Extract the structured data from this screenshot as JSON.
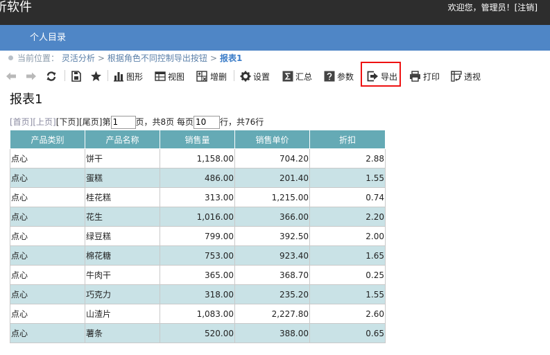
{
  "header": {
    "app_title": "析软件",
    "welcome_prefix": "欢迎您，管理员！[",
    "logout": "注销",
    "welcome_suffix": "]"
  },
  "nav": {
    "item": "个人目录"
  },
  "breadcrumb": {
    "label": "当前位置：",
    "items": [
      "灵活分析",
      "根据角色不同控制导出按钮",
      "报表1"
    ],
    "separator": ">"
  },
  "toolbar": {
    "chart": "图形",
    "view": "视图",
    "edit": "增删",
    "settings": "设置",
    "summary": "汇总",
    "params": "参数",
    "export": "导出",
    "print": "打印",
    "pivot": "透视"
  },
  "report": {
    "title": "报表1"
  },
  "pager": {
    "first": "[首页]",
    "prev": "[上页]",
    "next": "[下页]",
    "last": "[尾页]",
    "page_prefix": "第",
    "page_value": "1",
    "page_mid": "页，共8页 每页",
    "size_value": "10",
    "size_suffix": "行，共76行"
  },
  "table": {
    "headers": [
      "产品类别",
      "产品名称",
      "销售量",
      "销售单价",
      "折扣"
    ],
    "rows": [
      [
        "点心",
        "饼干",
        "1,158.00",
        "704.20",
        "2.88"
      ],
      [
        "点心",
        "蛋糕",
        "486.00",
        "201.40",
        "1.55"
      ],
      [
        "点心",
        "桂花糕",
        "313.00",
        "1,215.00",
        "0.74"
      ],
      [
        "点心",
        "花生",
        "1,016.00",
        "366.00",
        "2.20"
      ],
      [
        "点心",
        "绿豆糕",
        "799.00",
        "392.50",
        "2.00"
      ],
      [
        "点心",
        "棉花糖",
        "753.00",
        "923.40",
        "1.65"
      ],
      [
        "点心",
        "牛肉干",
        "365.00",
        "368.70",
        "0.25"
      ],
      [
        "点心",
        "巧克力",
        "318.00",
        "235.20",
        "1.55"
      ],
      [
        "点心",
        "山渣片",
        "1,083.00",
        "2,227.80",
        "2.60"
      ],
      [
        "点心",
        "薯条",
        "520.00",
        "388.00",
        "0.65"
      ]
    ]
  },
  "colors": {
    "topbar": "#2d2d2d",
    "navbar": "#4f86c6",
    "table_header": "#65aab5",
    "row_alt": "#c9e2e6",
    "highlight": "#ee1111"
  }
}
